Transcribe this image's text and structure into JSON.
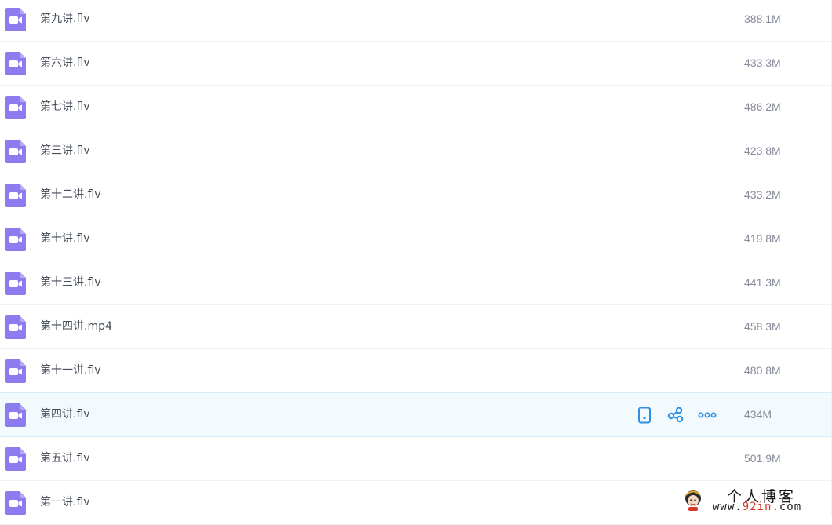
{
  "colors": {
    "icon_purple": "#8c7cf0",
    "action_blue": "#2f8fe6",
    "hover_bg": "#f2fafe",
    "text": "#454d5a",
    "size_text": "#878c9c"
  },
  "files": [
    {
      "name": "第九讲.flv",
      "size": "388.1M",
      "icon": "video-file-icon"
    },
    {
      "name": "第六讲.flv",
      "size": "433.3M",
      "icon": "video-file-icon"
    },
    {
      "name": "第七讲.flv",
      "size": "486.2M",
      "icon": "video-file-icon"
    },
    {
      "name": "第三讲.flv",
      "size": "423.8M",
      "icon": "video-file-icon"
    },
    {
      "name": "第十二讲.flv",
      "size": "433.2M",
      "icon": "video-file-icon"
    },
    {
      "name": "第十讲.flv",
      "size": "419.8M",
      "icon": "video-file-icon"
    },
    {
      "name": "第十三讲.flv",
      "size": "441.3M",
      "icon": "video-file-icon"
    },
    {
      "name": "第十四讲.mp4",
      "size": "458.3M",
      "icon": "video-file-icon"
    },
    {
      "name": "第十一讲.flv",
      "size": "480.8M",
      "icon": "video-file-icon"
    },
    {
      "name": "第四讲.flv",
      "size": "434M",
      "icon": "video-file-icon",
      "hovered": true,
      "actions": [
        "phone-icon",
        "share-icon",
        "more-icon"
      ]
    },
    {
      "name": "第五讲.flv",
      "size": "501.9M",
      "icon": "video-file-icon"
    },
    {
      "name": "第一讲.flv",
      "size": "",
      "icon": "video-file-icon"
    }
  ],
  "watermark": {
    "title": "个人博客",
    "url_prefix": "www.",
    "url_accent": "92in",
    "url_suffix": ".com"
  }
}
